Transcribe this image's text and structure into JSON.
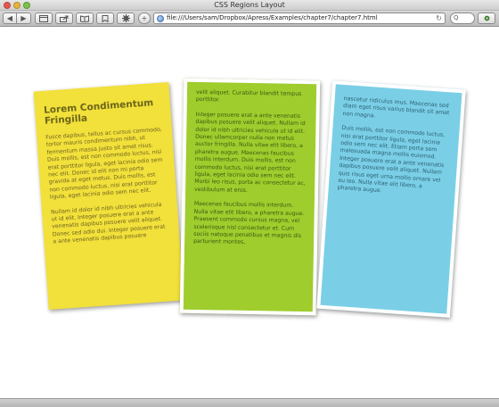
{
  "window": {
    "title": "CSS Regions Layout"
  },
  "toolbar": {
    "back_icon": "◀",
    "forward_icon": "▶",
    "plus_icon": "+",
    "url": "file:///Users/sam/Dropbox/Apress/Examples/chapter7/chapter7.html",
    "reload_icon": "↻",
    "search_icon": "Q"
  },
  "content": {
    "heading": "Lorem Condimentum Fringilla",
    "yellow_p1": "Fusce dapibus, tellus ac cursus commodo, tortor mauris condimentum nibh, ut fermentum massa justo sit amet risus. Duis mollis, est non commodo luctus, nisi erat porttitor ligula, eget lacinia odio sem nec elit. Donec id elit non mi porta gravida at eget metus. Duis mollis, est non commodo luctus, nisi erat porttitor ligula, eget lacinia odio sem nec elit.",
    "yellow_p2": "Nullam id dolor id nibh ultricies vehicula ut id elit. Integer posuere erat a ante venenatis dapibus posuere velit aliquet. Donec sed odio dui. Integer posuere erat a ante venenatis dapibus posuere",
    "green_p1": "velit aliquet. Curabitur blandit tempus porttitor.",
    "green_p2": "Integer posuere erat a ante venenatis dapibus posuere velit aliquet. Nullam id dolor id nibh ultricies vehicula ut id elit. Donec ullamcorper nulla non metus auctor fringilla. Nulla vitae elit libero, a pharetra augue. Maecenas faucibus mollis interdum. Duis mollis, est non commodo luctus, nisi erat porttitor ligula, eget lacinia odio sem nec elit. Morbi leo risus, porta ac consectetur ac, vestibulum at eros.",
    "green_p3": "Maecenas faucibus mollis interdum. Nulla vitae elit libero, a pharetra augue. Praesent commodo cursus magna, vel scelerisque nisl consectetur et. Cum sociis natoque penatibus et magnis dis parturient montes,",
    "blue_p1": "nascetur ridiculus mus. Maecenas sed diam eget risus varius blandit sit amet non magna.",
    "blue_p2": "Duis mollis, est non commodo luctus, nisi erat porttitor ligula, eget lacinia odio sem nec elit. Etiam porta sem malesuada magna mollis euismod. Integer posuere erat a ante venenatis dapibus posuere velit aliquet. Nullam quis risus eget urna mollis ornare vel eu leo. Nulla vitae elit libero, a pharetra augue."
  },
  "colors": {
    "yellow_panel": "#f2e03b",
    "green_panel": "#9fcd2d",
    "blue_panel": "#7acfe6"
  }
}
